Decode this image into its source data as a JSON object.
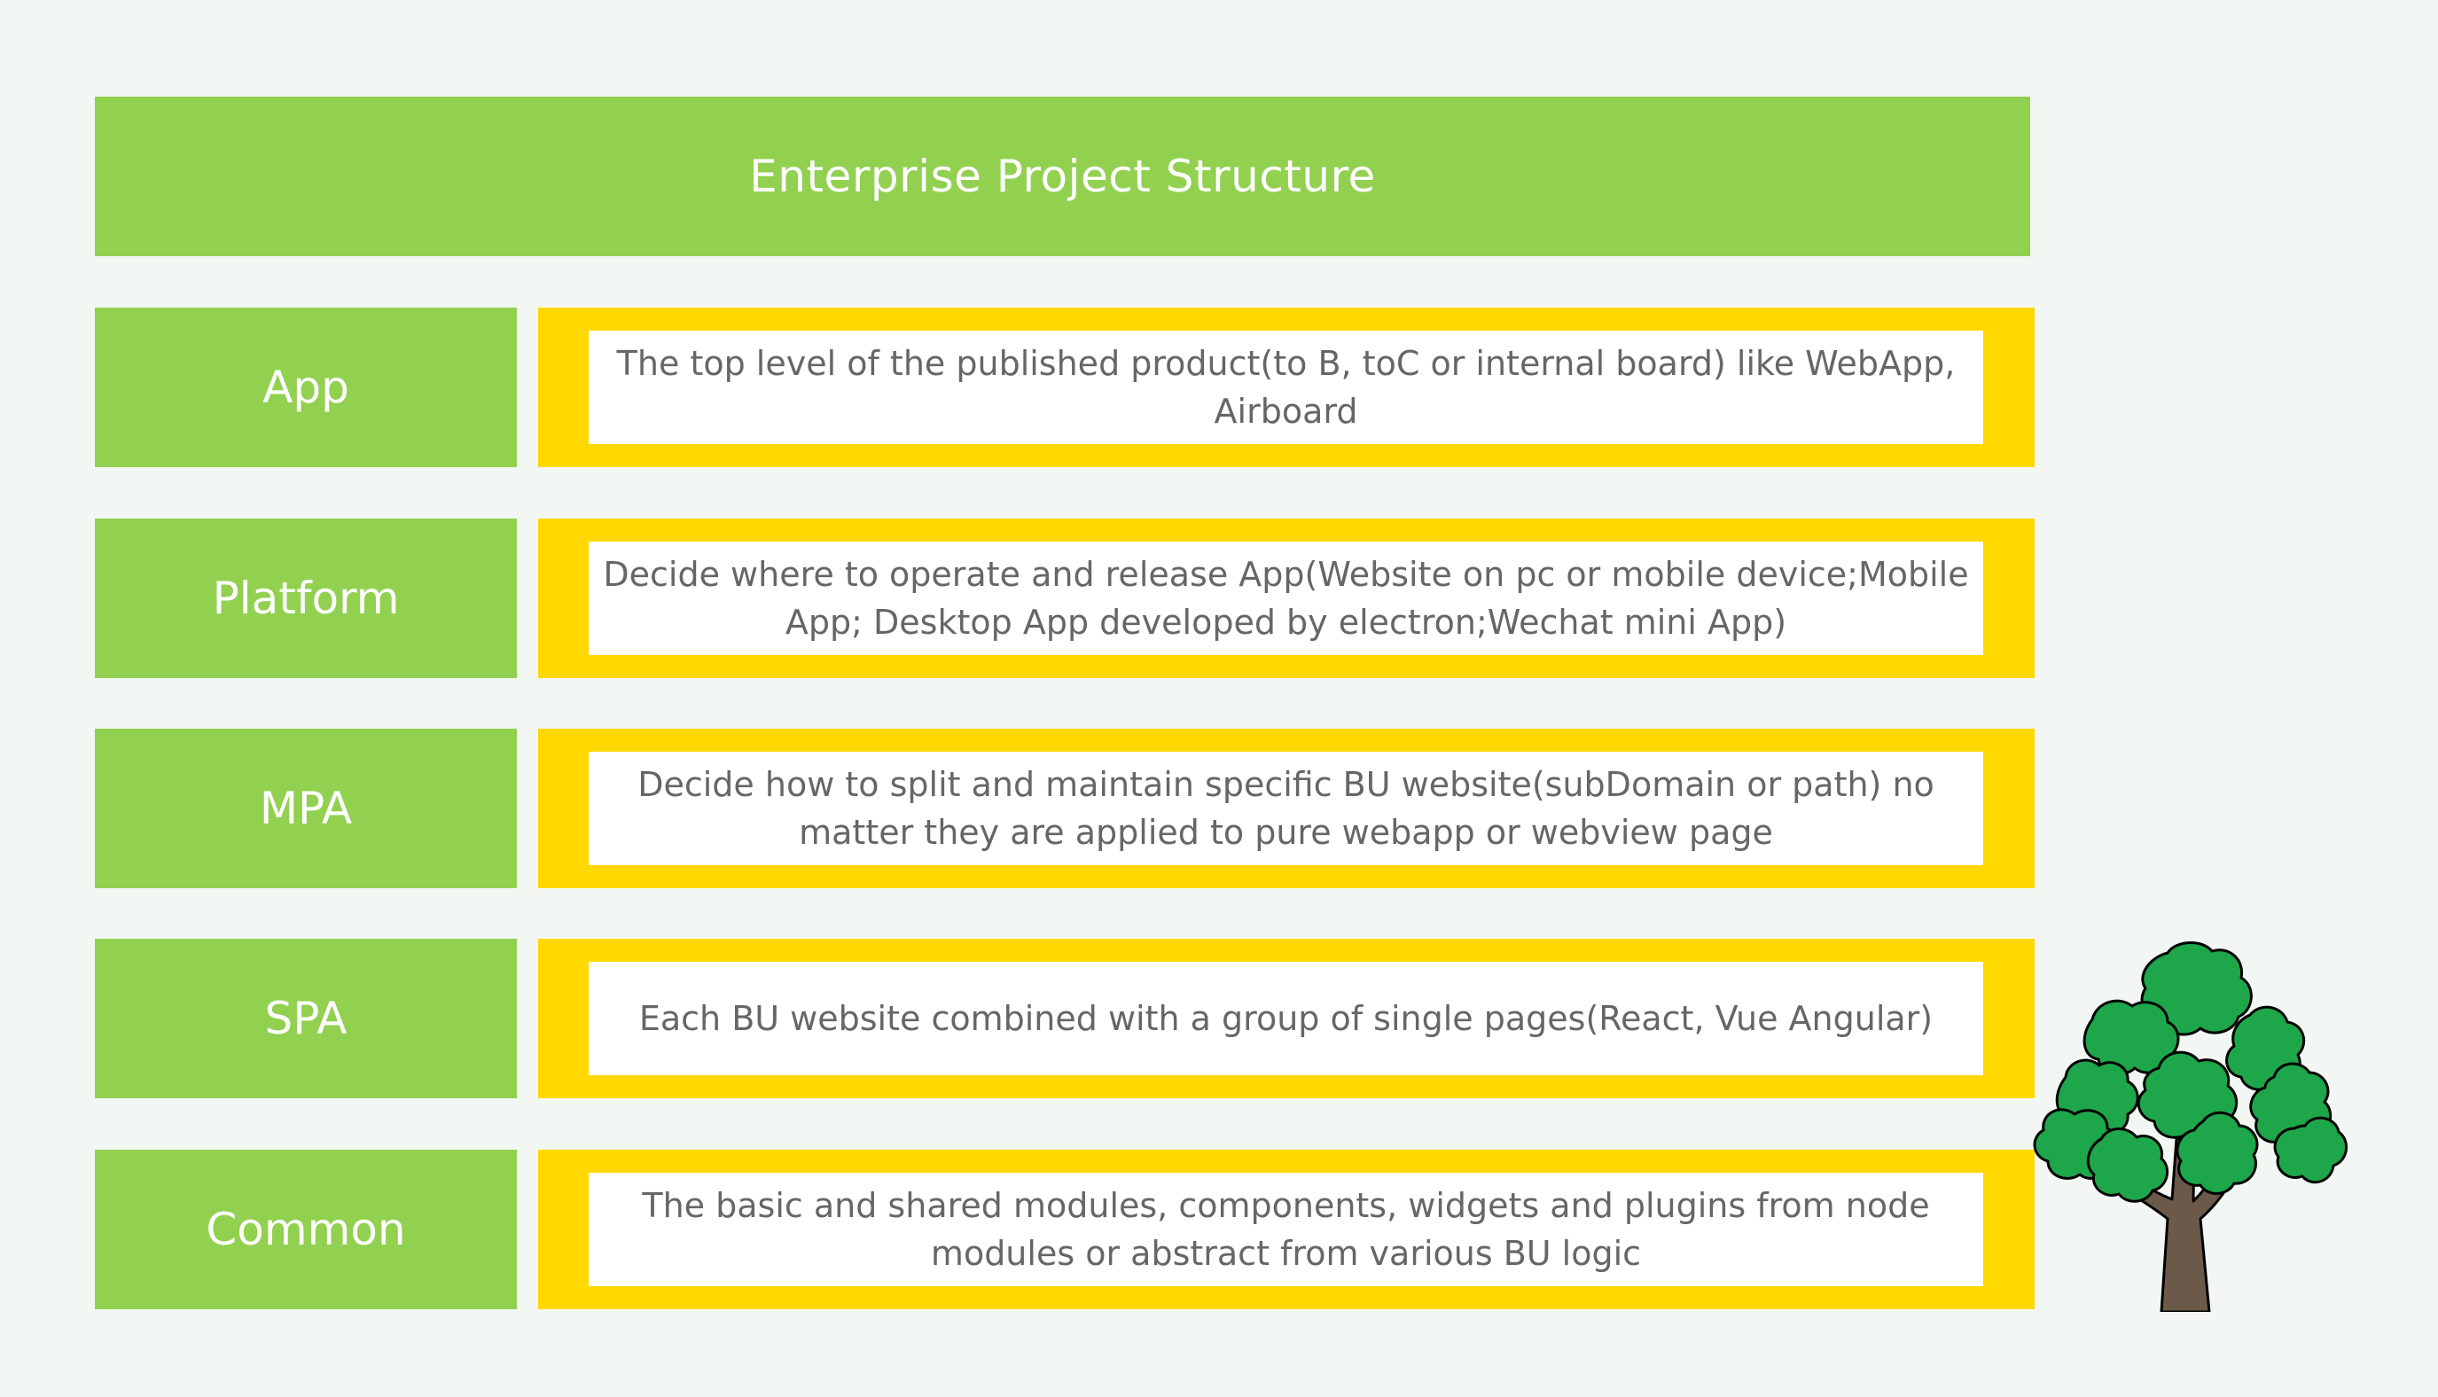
{
  "title": "Enterprise Project Structure",
  "rows": [
    {
      "label": "App",
      "description": "The top level of the published product(to B, toC or internal board) like WebApp, Airboard"
    },
    {
      "label": "Platform",
      "description": "Decide where to operate and release App(Website on pc or mobile device;Mobile App; Desktop App developed by electron;Wechat mini App)"
    },
    {
      "label": "MPA",
      "description": "Decide how to split and maintain specific BU website(subDomain or path) no matter  they are applied to pure webapp or webview page"
    },
    {
      "label": "SPA",
      "description": "Each BU website combined with a group of single pages(React, Vue Angular)"
    },
    {
      "label": "Common",
      "description": "The basic and shared  modules, components, widgets and plugins  from node modules or abstract from various BU logic"
    }
  ],
  "colors": {
    "label_fill": "#92d050",
    "frame_fill": "#ffd800",
    "description_text": "#666666",
    "tree_foliage": "#1ea64a",
    "tree_trunk": "#6b5a4a"
  },
  "icons": {
    "decoration": "tree-icon"
  }
}
